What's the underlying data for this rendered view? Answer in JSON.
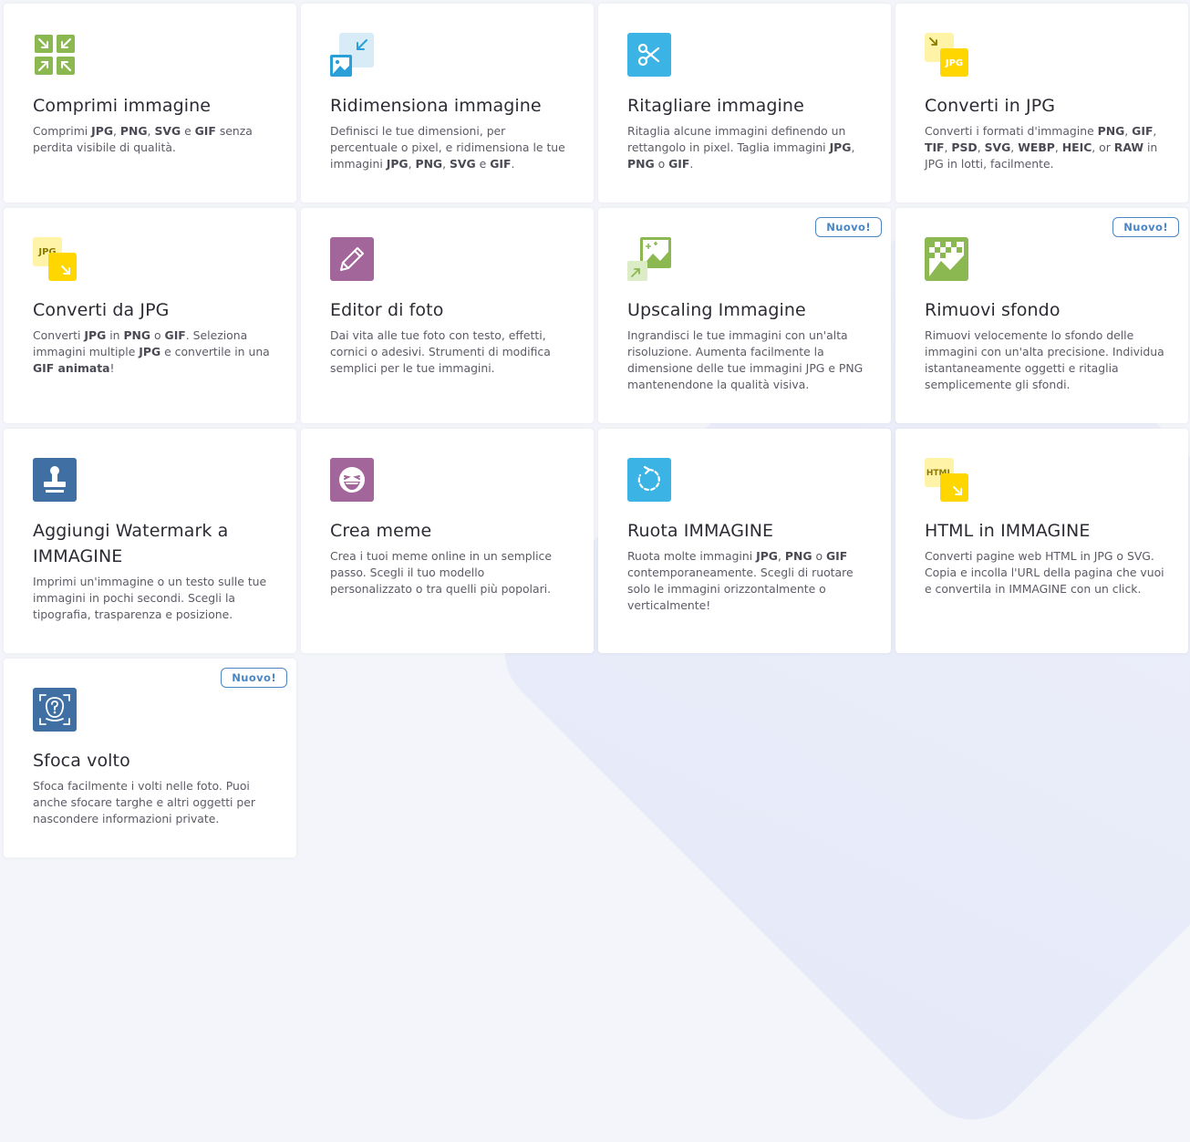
{
  "badge_label": "Nuovo!",
  "colors": {
    "green": "#8cb852",
    "lightblue": "#d7ecf7",
    "blue": "#3bb3e4",
    "yellow": "#ffd600",
    "paleyellow": "#fff3a8",
    "purple": "#a2669b",
    "steelblue": "#3f6fa3",
    "badge": "#4a86c5"
  },
  "tools": [
    {
      "title": "Comprimi immagine",
      "icon": "compress-icon",
      "desc": [
        [
          "Comprimi ",
          ""
        ],
        [
          "JPG",
          "b"
        ],
        [
          ", ",
          ""
        ],
        [
          "PNG",
          "b"
        ],
        [
          ", ",
          ""
        ],
        [
          "SVG",
          "b"
        ],
        [
          " e ",
          ""
        ],
        [
          "GIF",
          "b"
        ],
        [
          " senza perdita visibile di qualità.",
          ""
        ]
      ]
    },
    {
      "title": "Ridimensiona immagine",
      "icon": "resize-icon",
      "desc": [
        [
          "Definisci le tue dimensioni, per percentuale o pixel, e ridimensiona le tue immagini ",
          ""
        ],
        [
          "JPG",
          "b"
        ],
        [
          ", ",
          ""
        ],
        [
          "PNG",
          "b"
        ],
        [
          ", ",
          ""
        ],
        [
          "SVG",
          "b"
        ],
        [
          " e ",
          ""
        ],
        [
          "GIF",
          "b"
        ],
        [
          ".",
          ""
        ]
      ]
    },
    {
      "title": "Ritagliare immagine",
      "icon": "scissors-icon",
      "desc": [
        [
          "Ritaglia alcune immagini definendo un rettangolo in pixel. Taglia immagini ",
          ""
        ],
        [
          "JPG",
          "b"
        ],
        [
          ", ",
          ""
        ],
        [
          "PNG",
          "b"
        ],
        [
          " o ",
          ""
        ],
        [
          "GIF",
          "b"
        ],
        [
          ".",
          ""
        ]
      ]
    },
    {
      "title": "Converti in JPG",
      "icon": "convert-to-jpg-icon",
      "icon_text": "JPG",
      "desc": [
        [
          "Converti i formati d'immagine ",
          ""
        ],
        [
          "PNG",
          "b"
        ],
        [
          ", ",
          ""
        ],
        [
          "GIF",
          "b"
        ],
        [
          ", ",
          ""
        ],
        [
          "TIF",
          "b"
        ],
        [
          ", ",
          ""
        ],
        [
          "PSD",
          "b"
        ],
        [
          ", ",
          ""
        ],
        [
          "SVG",
          "b"
        ],
        [
          ", ",
          ""
        ],
        [
          "WEBP",
          "b"
        ],
        [
          ", ",
          ""
        ],
        [
          "HEIC",
          "b"
        ],
        [
          ", or ",
          ""
        ],
        [
          "RAW",
          "b"
        ],
        [
          " in JPG in lotti, facilmente.",
          ""
        ]
      ]
    },
    {
      "title": "Converti da JPG",
      "icon": "convert-from-jpg-icon",
      "icon_text": "JPG",
      "desc": [
        [
          "Converti ",
          ""
        ],
        [
          "JPG",
          "b"
        ],
        [
          " in ",
          ""
        ],
        [
          "PNG",
          "b"
        ],
        [
          " o ",
          ""
        ],
        [
          "GIF",
          "b"
        ],
        [
          ". Seleziona immagini multiple ",
          ""
        ],
        [
          "JPG",
          "b"
        ],
        [
          " e convertile in una ",
          ""
        ],
        [
          "GIF animata",
          "b"
        ],
        [
          "!",
          ""
        ]
      ]
    },
    {
      "title": "Editor di foto",
      "icon": "pencil-icon",
      "desc": [
        [
          "Dai vita alle tue foto con testo, effetti, cornici o adesivi. Strumenti di modifica semplici per le tue immagini.",
          ""
        ]
      ]
    },
    {
      "title": "Upscaling Immagine",
      "icon": "upscale-icon",
      "is_new": true,
      "desc": [
        [
          "Ingrandisci le tue immagini con un'alta risoluzione. Aumenta facilmente la dimensione delle tue immagini JPG e PNG mantenendone la qualità visiva.",
          ""
        ]
      ]
    },
    {
      "title": "Rimuovi sfondo",
      "icon": "remove-background-icon",
      "is_new": true,
      "desc": [
        [
          "Rimuovi velocemente lo sfondo delle immagini con un'alta precisione. Individua istantaneamente oggetti e ritaglia semplicemente gli sfondi.",
          ""
        ]
      ]
    },
    {
      "title": "Aggiungi Watermark a IMMAGINE",
      "icon": "stamp-icon",
      "two_line": true,
      "desc": [
        [
          "Imprimi un'immagine o un testo sulle tue immagini in pochi secondi. Scegli la tipografia, trasparenza e posizione.",
          ""
        ]
      ]
    },
    {
      "title": "Crea meme",
      "icon": "meme-face-icon",
      "desc": [
        [
          "Crea i tuoi meme online in un semplice passo. Scegli il tuo modello personalizzato o tra quelli più popolari.",
          ""
        ]
      ]
    },
    {
      "title": "Ruota IMMAGINE",
      "icon": "rotate-icon",
      "desc": [
        [
          "Ruota molte immagini ",
          ""
        ],
        [
          "JPG",
          "b"
        ],
        [
          ", ",
          ""
        ],
        [
          "PNG",
          "b"
        ],
        [
          " o ",
          ""
        ],
        [
          "GIF",
          "b"
        ],
        [
          " contemporaneamente. Scegli di ruotare solo le immagini orizzontalmente o verticalmente!",
          ""
        ]
      ]
    },
    {
      "title": "HTML in IMMAGINE",
      "icon": "html-to-image-icon",
      "icon_text": "HTML",
      "desc": [
        [
          "Converti pagine web HTML in JPG o SVG. Copia e incolla l'URL della pagina che vuoi e convertila in IMMAGINE con un click.",
          ""
        ]
      ]
    },
    {
      "title": "Sfoca volto",
      "icon": "blur-face-icon",
      "is_new": true,
      "desc": [
        [
          "Sfoca facilmente i volti nelle foto. Puoi anche sfocare targhe e altri oggetti per nascondere informazioni private.",
          ""
        ]
      ]
    }
  ]
}
